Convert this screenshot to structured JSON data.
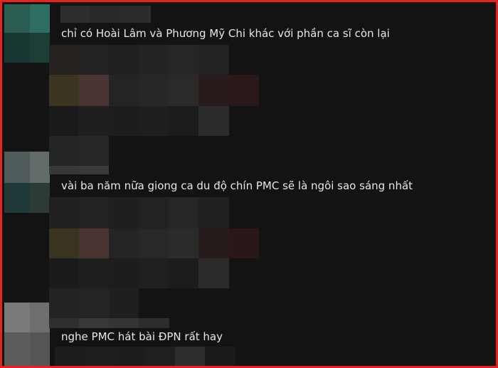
{
  "screen": {
    "type": "pixelated comments screenshot",
    "frame_color": "#e52420",
    "background_color": "#131313",
    "text_color": "#e7e7e7"
  },
  "comments": [
    {
      "text": "chỉ có Hoài Lâm và Phương Mỹ Chi khác với phần ca sĩ còn lại",
      "avatar_icon": "pixelated-avatar-icon"
    },
    {
      "text": "vài ba năm nữa giong ca du độ chín PMC sẽ là ngôi sao sáng nhất",
      "avatar_icon": "pixelated-avatar-icon"
    },
    {
      "text": "nghe PMC hát bài ĐPN rất hay",
      "avatar_icon": "pixelated-avatar-icon"
    }
  ]
}
